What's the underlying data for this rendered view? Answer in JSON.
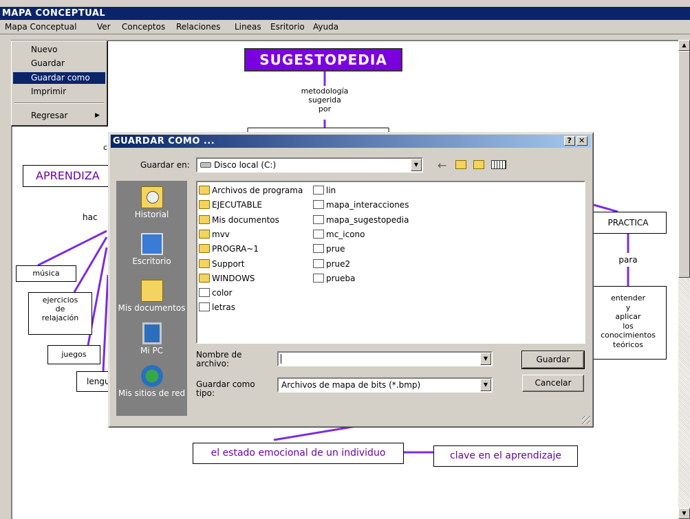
{
  "window": {
    "title": "MAPA CONCEPTUAL"
  },
  "menubar": [
    {
      "label": "Mapa Conceptual",
      "x": 0
    },
    {
      "label": "Ver"
    },
    {
      "label": "Conceptos"
    },
    {
      "label": "Relaciones"
    },
    {
      "label": "Lineas"
    },
    {
      "label": "Esritorio"
    },
    {
      "label": "Ayuda"
    }
  ],
  "file_menu": {
    "items": [
      "Nuevo",
      "Guardar",
      "Guardar como",
      "Imprimir"
    ],
    "selected": "Guardar como",
    "submenu_item": "Regresar",
    "submenu_arrow": "▶"
  },
  "concept_map": {
    "title": "SUGESTOPEDIA",
    "title_link": "metodología\nsugerida\npor",
    "node_aprendizaje": "APRENDIZA",
    "node_musica": "música",
    "node_ejercicios": "ejercicios\nde\nrelajación",
    "node_juegos": "juegos",
    "node_lengu": "lengu",
    "label_hac": "hac",
    "label_c": "c",
    "node_practica": "PRACTICA",
    "label_para": "para",
    "node_entender": "entender\ny\naplicar\nlos\nconocimientos\nteóricos",
    "node_estado": "el estado emocional de un individuo",
    "node_clave": "clave en el aprendizaje",
    "colors": {
      "title_bg": "#7b00e0",
      "title_fg": "#ffffff",
      "link_line": "#7b2be2",
      "node_purple_text": "#6a00aa"
    }
  },
  "dialog": {
    "title": "GUARDAR COMO ...",
    "help_btn": "?",
    "close_btn": "✕",
    "save_in_label": "Guardar en:",
    "save_in_value": "Disco local (C:)",
    "places": [
      "Historial",
      "Escritorio",
      "Mis documentos",
      "Mi PC",
      "Mis sitios de red"
    ],
    "files_col1": [
      {
        "name": "Archivos de programa",
        "type": "folder"
      },
      {
        "name": "EJECUTABLE",
        "type": "folder"
      },
      {
        "name": "Mis documentos",
        "type": "folder"
      },
      {
        "name": "mvv",
        "type": "folder"
      },
      {
        "name": "PROGRA~1",
        "type": "folder"
      },
      {
        "name": "Support",
        "type": "folder"
      },
      {
        "name": "WINDOWS",
        "type": "folder"
      },
      {
        "name": "color",
        "type": "map"
      },
      {
        "name": "letras",
        "type": "map"
      }
    ],
    "files_col2": [
      {
        "name": "lin",
        "type": "map"
      },
      {
        "name": "mapa_interacciones",
        "type": "map"
      },
      {
        "name": "mapa_sugestopedia",
        "type": "map"
      },
      {
        "name": "mc_icono",
        "type": "map"
      },
      {
        "name": "prue",
        "type": "map"
      },
      {
        "name": "prue2",
        "type": "map"
      },
      {
        "name": "prueba",
        "type": "map"
      }
    ],
    "filename_label": "Nombre de\narchivo:",
    "filename_value": "",
    "filetype_label": "Guardar como\ntipo:",
    "filetype_value": "Archivos de mapa de bits (*.bmp)",
    "save_button": "Guardar",
    "cancel_button": "Cancelar"
  }
}
